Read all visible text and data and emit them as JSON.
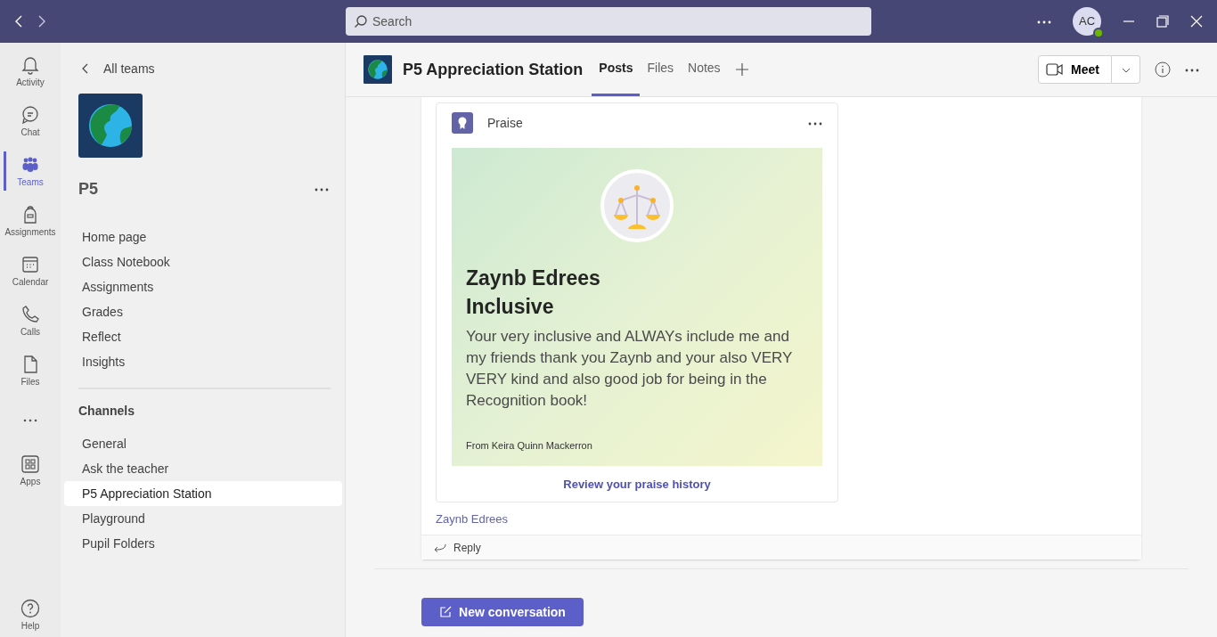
{
  "title_bar": {
    "search": {
      "placeholder": "Search"
    },
    "avatar": {
      "initials": "AC",
      "online": true
    }
  },
  "app_rail": {
    "items": [
      {
        "label": "Activity",
        "kind": "bell",
        "selected": false
      },
      {
        "label": "Chat",
        "kind": "chat",
        "selected": false
      },
      {
        "label": "Teams",
        "kind": "teams",
        "selected": true
      },
      {
        "label": "Assignments",
        "kind": "backpack",
        "selected": false
      },
      {
        "label": "Calendar",
        "kind": "calendar",
        "selected": false
      },
      {
        "label": "Calls",
        "kind": "phone",
        "selected": false
      },
      {
        "label": "Files",
        "kind": "file",
        "selected": false
      },
      {
        "kind": "more",
        "selected": false
      },
      {
        "label": "Apps",
        "kind": "apps",
        "selected": false
      }
    ],
    "help": "Help"
  },
  "team_panel": {
    "back": "All teams",
    "team_name": "P5",
    "nav_items": [
      {
        "label": "Home page",
        "selected": false
      },
      {
        "label": "Class Notebook",
        "selected": false
      },
      {
        "label": "Assignments",
        "selected": false
      },
      {
        "label": "Grades",
        "selected": false
      },
      {
        "label": "Reflect",
        "selected": false
      },
      {
        "label": "Insights",
        "selected": false
      }
    ],
    "channels_heading": "Channels",
    "channels": [
      {
        "label": "General",
        "selected": false
      },
      {
        "label": "Ask the teacher",
        "selected": false
      },
      {
        "label": "P5 Appreciation Station",
        "selected": true
      },
      {
        "label": "Playground",
        "selected": false
      },
      {
        "label": "Pupil Folders",
        "selected": false
      }
    ]
  },
  "channel_header": {
    "title": "P5 Appreciation Station",
    "tabs": [
      {
        "label": "Posts",
        "selected": true
      },
      {
        "label": "Files",
        "selected": false
      },
      {
        "label": "Notes",
        "selected": false
      }
    ],
    "meet_button": "Meet"
  },
  "post": {
    "card_label": "Praise",
    "praise": {
      "recipient": "Zaynb Edrees",
      "badge": "Inclusive",
      "message": "Your very inclusive and ALWAYs include me and my friends thank you Zaynb and your also VERY VERY kind and also good job for being in the Recognition book!",
      "from": "From Keira Quinn Mackerron"
    },
    "history_link": "Review your praise history",
    "mention": "Zaynb Edrees",
    "reply": "Reply"
  },
  "new_conversation": "New conversation"
}
